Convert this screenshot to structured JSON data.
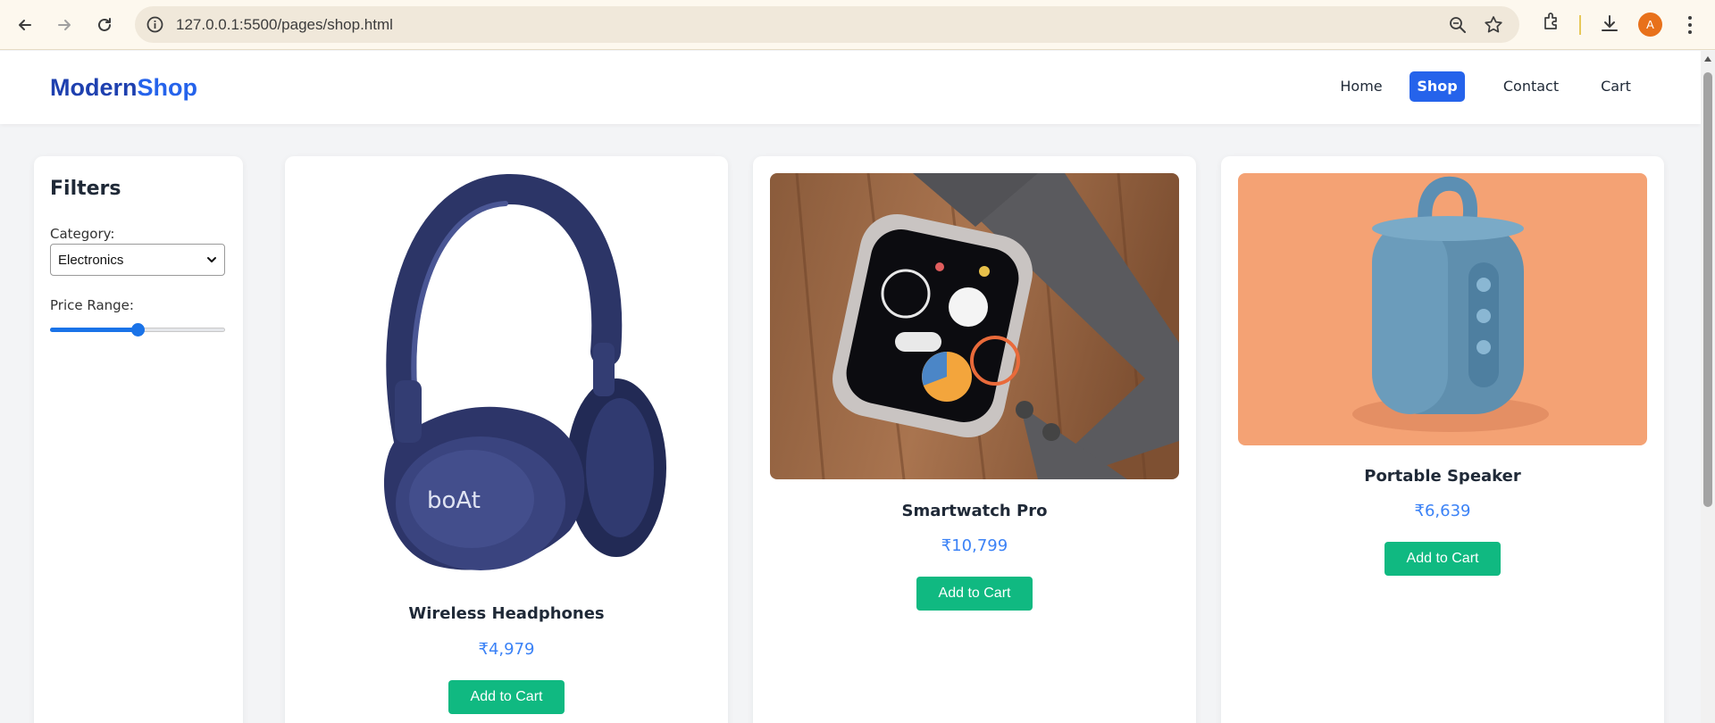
{
  "browser": {
    "url": "127.0.0.1:5500/pages/shop.html",
    "profile_initial": "A",
    "icons": [
      "back-arrow-icon",
      "forward-arrow-icon",
      "reload-icon",
      "site-info-icon",
      "zoom-icon",
      "bookmark-star-icon",
      "extensions-icon",
      "download-icon",
      "menu-dots-icon"
    ]
  },
  "header": {
    "logo_part1": "Modern",
    "logo_part2": "Shop",
    "nav": [
      {
        "label": "Home",
        "active": false
      },
      {
        "label": "Shop",
        "active": true
      },
      {
        "label": "Contact",
        "active": false
      },
      {
        "label": "Cart",
        "active": false
      }
    ]
  },
  "filters": {
    "title": "Filters",
    "category_label": "Category:",
    "category_value": "Electronics",
    "price_label": "Price Range:",
    "price_range_fraction": 0.5
  },
  "products": [
    {
      "name": "Wireless Headphones",
      "price": "₹4,979",
      "button": "Add to Cart",
      "image": "headphones-image"
    },
    {
      "name": "Smartwatch Pro",
      "price": "₹10,799",
      "button": "Add to Cart",
      "image": "smartwatch-image"
    },
    {
      "name": "Portable Speaker",
      "price": "₹6,639",
      "button": "Add to Cart",
      "image": "speaker-image"
    }
  ],
  "colors": {
    "brand_dark": "#1e40af",
    "brand": "#2563eb",
    "price": "#3b82f6",
    "cart_button": "#10b981",
    "profile": "#e8711b"
  }
}
